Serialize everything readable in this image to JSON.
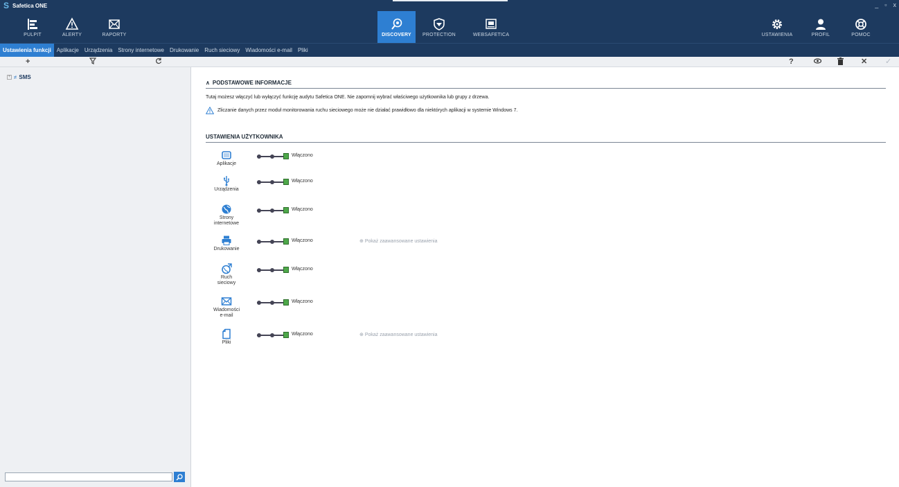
{
  "window": {
    "title": "Safetica ONE",
    "controls": [
      "_",
      "▫",
      "x"
    ]
  },
  "nav": {
    "left": [
      {
        "label": "PULPIT",
        "icon": "dashboard-icon"
      },
      {
        "label": "ALERTY",
        "icon": "alert-icon"
      },
      {
        "label": "RAPORTY",
        "icon": "mail-icon"
      }
    ],
    "center": [
      {
        "label": "DISCOVERY",
        "icon": "discovery-icon",
        "active": true
      },
      {
        "label": "PROTECTION",
        "icon": "shield-icon"
      },
      {
        "label": "WEBSAFETICA",
        "icon": "websafetica-icon"
      }
    ],
    "right": [
      {
        "label": "USTAWIENIA",
        "icon": "gear-icon"
      },
      {
        "label": "PROFIL",
        "icon": "user-icon"
      },
      {
        "label": "POMOC",
        "icon": "help-icon"
      }
    ]
  },
  "subnav": [
    {
      "label": "Ustawienia funkcji",
      "active": true
    },
    {
      "label": "Aplikacje"
    },
    {
      "label": "Urządzenia"
    },
    {
      "label": "Strony internetowe"
    },
    {
      "label": "Drukowanie"
    },
    {
      "label": "Ruch sieciowy"
    },
    {
      "label": "Wiadomości e-mail"
    },
    {
      "label": "Pliki"
    }
  ],
  "tree": {
    "root_label": "SMS"
  },
  "search": {
    "placeholder": ""
  },
  "sections": {
    "basic": {
      "title": "PODSTAWOWE INFORMACJE",
      "info": "Tutaj możesz włączyć lub wyłączyć funkcję audytu Safetica ONE. Nie zapomnij wybrać właściwego użytkownika lub grupy z drzewa.",
      "warning": "Zliczanie danych przez moduł monitorowania ruchu sieciowego może nie działać prawidłowo dla niektórych aplikacji w systemie Windows 7."
    },
    "user": {
      "title": "USTAWIENIA UŻYTKOWNIKA"
    }
  },
  "features": [
    {
      "label_lines": [
        "Aplikacje"
      ],
      "state": "Włączono",
      "enabled": 1,
      "advanced": ""
    },
    {
      "label_lines": [
        "Urządzenia"
      ],
      "state": "Włączono",
      "enabled": 1,
      "advanced": ""
    },
    {
      "label_lines": [
        "Strony",
        "internetowe"
      ],
      "state": "Włączono",
      "enabled": 1,
      "advanced": ""
    },
    {
      "label_lines": [
        "Drukowanie"
      ],
      "state": "Włączono",
      "enabled": 1,
      "advanced": "Pokaż zaawansowane ustawienia"
    },
    {
      "label_lines": [
        "Ruch",
        "sieciowy"
      ],
      "state": "Włączono",
      "enabled": 1,
      "advanced": ""
    },
    {
      "label_lines": [
        "Wiadomości",
        "e-mail"
      ],
      "state": "Włączono",
      "enabled": 1,
      "advanced": ""
    },
    {
      "label_lines": [
        "Pliki"
      ],
      "state": "Włączono",
      "enabled": 1,
      "advanced": "Pokaż zaawansowane ustawienia"
    }
  ],
  "colors": {
    "nav_bg": "#1d3a5f",
    "accent": "#2e7fd2",
    "toggle_on": "#4ea84a"
  }
}
